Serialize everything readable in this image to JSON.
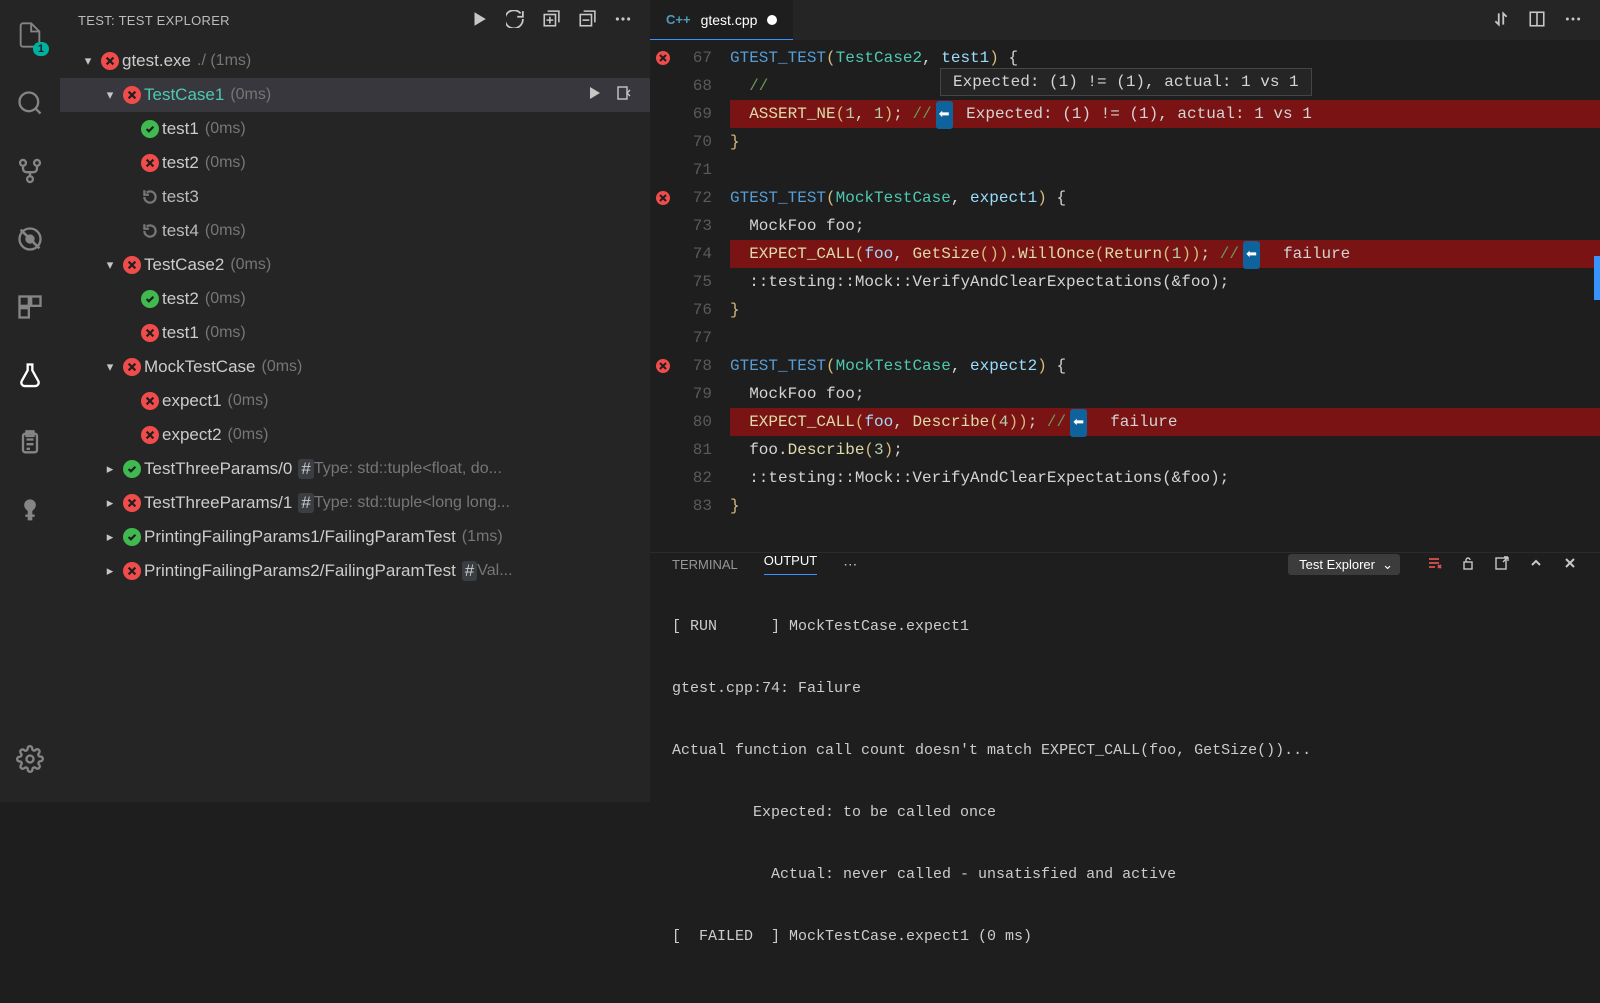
{
  "sidebar": {
    "title": "TEST: TEST EXPLORER",
    "badge": "1",
    "tree": {
      "root": {
        "label": "gtest.exe",
        "hint": "./ (1ms)"
      },
      "tc1": {
        "label": "TestCase1",
        "hint": "(0ms)",
        "t1": {
          "label": "test1",
          "hint": "(0ms)"
        },
        "t2": {
          "label": "test2",
          "hint": "(0ms)"
        },
        "t3": {
          "label": "test3"
        },
        "t4": {
          "label": "test4",
          "hint": "(0ms)"
        }
      },
      "tc2": {
        "label": "TestCase2",
        "hint": "(0ms)",
        "t2": {
          "label": "test2",
          "hint": "(0ms)"
        },
        "t1": {
          "label": "test1",
          "hint": "(0ms)"
        }
      },
      "mock": {
        "label": "MockTestCase",
        "hint": "(0ms)",
        "e1": {
          "label": "expect1",
          "hint": "(0ms)"
        },
        "e2": {
          "label": "expect2",
          "hint": "(0ms)"
        }
      },
      "tp0": {
        "label": "TestThreeParams/0",
        "type_hint": "Type: std::tuple<float, do..."
      },
      "tp1": {
        "label": "TestThreeParams/1",
        "type_hint": "Type: std::tuple<long long..."
      },
      "pf1": {
        "label": "PrintingFailingParams1/FailingParamTest",
        "hint": "(1ms)"
      },
      "pf2": {
        "label": "PrintingFailingParams2/FailingParamTest",
        "type_hint": "Val..."
      }
    }
  },
  "editor": {
    "tab_label": "gtest.cpp",
    "hover": "Expected: (1) != (1), actual: 1 vs 1",
    "lines": {
      "67": "67",
      "68": "68",
      "69": "69",
      "70": "70",
      "71": "71",
      "72": "72",
      "73": "73",
      "74": "74",
      "75": "75",
      "76": "76",
      "77": "77",
      "78": "78",
      "79": "79",
      "80": "80",
      "81": "81",
      "82": "82",
      "83": "83"
    },
    "code": {
      "l67a": "GTEST_TEST",
      "l67b": "TestCase2",
      "l67c": "test1",
      "l68": "  //",
      "l69a": "  ASSERT_NE",
      "l69b": "1",
      "l69c": "1",
      "l69comment": " Expected: (1) != (1), actual: 1 vs 1",
      "l70": "}",
      "l72a": "GTEST_TEST",
      "l72b": "MockTestCase",
      "l72c": "expect1",
      "l73": "  MockFoo foo;",
      "l74a": "  EXPECT_CALL",
      "l74b": "foo",
      "l74c": "GetSize",
      "l74d": "WillOnce",
      "l74e": "Return",
      "l74f": "1",
      "l74comment": "  failure",
      "l75": "  ::testing::Mock::VerifyAndClearExpectations(&foo);",
      "l76": "}",
      "l78a": "GTEST_TEST",
      "l78b": "MockTestCase",
      "l78c": "expect2",
      "l79": "  MockFoo foo;",
      "l80a": "  EXPECT_CALL",
      "l80b": "foo",
      "l80c": "Describe",
      "l80d": "4",
      "l80comment": "  failure",
      "l81a": "  foo.",
      "l81b": "Describe",
      "l81c": "3",
      "l82": "  ::testing::Mock::VerifyAndClearExpectations(&foo);",
      "l83": "}"
    }
  },
  "panel": {
    "tabs": {
      "terminal": "TERMINAL",
      "output": "OUTPUT"
    },
    "select": "Test Explorer",
    "output": {
      "l1": "[ RUN      ] MockTestCase.expect1",
      "l2": "gtest.cpp:74: Failure",
      "l3": "Actual function call count doesn't match EXPECT_CALL(foo, GetSize())...",
      "l4": "         Expected: to be called once",
      "l5": "           Actual: never called - unsatisfied and active",
      "l6": "[  FAILED  ] MockTestCase.expect1 (0 ms)"
    }
  }
}
